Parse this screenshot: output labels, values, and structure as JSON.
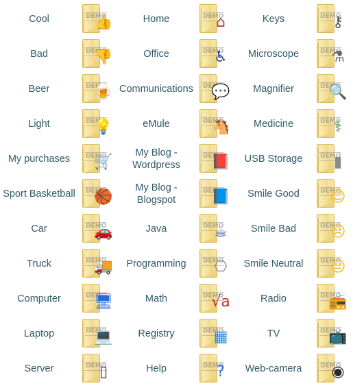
{
  "watermark": "DEMO",
  "items": [
    {
      "label": "Cool",
      "icon": "thumbs-up-icon",
      "glyph": "👍",
      "color": "#d9925a"
    },
    {
      "label": "Home",
      "icon": "house-icon",
      "glyph": "⌂",
      "color": "#b5452c"
    },
    {
      "label": "Keys",
      "icon": "keys-icon",
      "glyph": "⚷",
      "color": "#555555"
    },
    {
      "label": "Bad",
      "icon": "thumbs-down-icon",
      "glyph": "👎",
      "color": "#d9925a"
    },
    {
      "label": "Office",
      "icon": "office-chair-icon",
      "glyph": "♿",
      "color": "#2a3f8f"
    },
    {
      "label": "Microscope",
      "icon": "microscope-icon",
      "glyph": "⚗",
      "color": "#606a72"
    },
    {
      "label": "Beer",
      "icon": "beer-mug-icon",
      "glyph": "🍺",
      "color": "#d98a1c"
    },
    {
      "label": "Communications",
      "icon": "chat-bubbles-icon",
      "glyph": "💬",
      "color": "#4a8fd8"
    },
    {
      "label": "Magnifier",
      "icon": "magnifier-icon",
      "glyph": "🔍",
      "color": "#3a7fc8"
    },
    {
      "label": "Light",
      "icon": "light-bulb-icon",
      "glyph": "💡",
      "color": "#f0c020"
    },
    {
      "label": "eMule",
      "icon": "mule-icon",
      "glyph": "🐴",
      "color": "#6b4a2a"
    },
    {
      "label": "Medicine",
      "icon": "caduceus-icon",
      "glyph": "⚕",
      "color": "#3a9a4a"
    },
    {
      "label": "My purchases",
      "icon": "shopping-cart-icon",
      "glyph": "🛒",
      "color": "#2a9a4a"
    },
    {
      "label": "My Blog - Wordpress",
      "icon": "wordpress-book-icon",
      "glyph": "📕",
      "color": "#6b3a20"
    },
    {
      "label": "USB Storage",
      "icon": "usb-drive-icon",
      "glyph": "▮",
      "color": "#8a8a8a"
    },
    {
      "label": "Sport Basketball",
      "icon": "basketball-icon",
      "glyph": "🏀",
      "color": "#d8621c"
    },
    {
      "label": "My Blog - Blogspot",
      "icon": "blogspot-book-icon",
      "glyph": "📘",
      "color": "#2a6ac8"
    },
    {
      "label": "Smile Good",
      "icon": "smile-good-icon",
      "glyph": "😊",
      "color": "#f0b820"
    },
    {
      "label": "Car",
      "icon": "car-icon",
      "glyph": "🚗",
      "color": "#d82a2a"
    },
    {
      "label": "Java",
      "icon": "java-cup-icon",
      "glyph": "☕",
      "color": "#2a5aa8"
    },
    {
      "label": "Smile Bad",
      "icon": "smile-bad-icon",
      "glyph": "☹",
      "color": "#f0b820"
    },
    {
      "label": "Truck",
      "icon": "truck-icon",
      "glyph": "🚚",
      "color": "#2a7ab8"
    },
    {
      "label": "Programming",
      "icon": "flowchart-icon",
      "glyph": "⎔",
      "color": "#7a8aa8"
    },
    {
      "label": "Smile Neutral",
      "icon": "smile-neutral-icon",
      "glyph": "😐",
      "color": "#f0b820"
    },
    {
      "label": "Computer",
      "icon": "monitor-icon",
      "glyph": "🖥",
      "color": "#2a6ad8"
    },
    {
      "label": "Math",
      "icon": "math-sqrt-icon",
      "glyph": "√a",
      "color": "#c82a2a"
    },
    {
      "label": "Radio",
      "icon": "radio-icon",
      "glyph": "📻",
      "color": "#6a6a6a"
    },
    {
      "label": "Laptop",
      "icon": "laptop-icon",
      "glyph": "💻",
      "color": "#3a3a3a"
    },
    {
      "label": "Registry",
      "icon": "registry-cubes-icon",
      "glyph": "▦",
      "color": "#2a8ad8"
    },
    {
      "label": "TV",
      "icon": "tv-icon",
      "glyph": "📺",
      "color": "#2a2a2a"
    },
    {
      "label": "Server",
      "icon": "server-tower-icon",
      "glyph": "▯",
      "color": "#3a3a3a"
    },
    {
      "label": "Help",
      "icon": "help-question-icon",
      "glyph": "?",
      "color": "#2a6ad8"
    },
    {
      "label": "Web-camera",
      "icon": "webcam-icon",
      "glyph": "◉",
      "color": "#2a2a2a"
    }
  ]
}
